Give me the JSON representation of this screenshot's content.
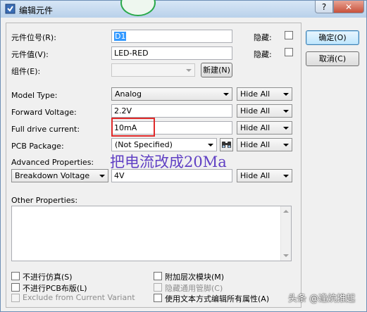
{
  "window": {
    "title": "编辑元件",
    "help_button": "?",
    "close_button": "✕"
  },
  "fields": {
    "ref_label": "元件位号(R):",
    "ref_value": "D1",
    "value_label": "元件值(V):",
    "value_value": "LED-RED",
    "group_label": "组件(E):",
    "new_button": "新建(N)",
    "hidden_label": "隐藏:"
  },
  "properties": [
    {
      "label": "Model Type:",
      "value": "Analog",
      "hide": "Hide All"
    },
    {
      "label": "Forward Voltage:",
      "value": "2.2V",
      "hide": "Hide All"
    },
    {
      "label": "Full drive current:",
      "value": "10mA",
      "hide": "Hide All"
    },
    {
      "label": "PCB Package:",
      "value": "(Not Specified)",
      "hide": "Hide All"
    },
    {
      "label": "Advanced Properties:",
      "value": "4V",
      "hide": "Hide All",
      "selector": "Breakdown Voltage"
    }
  ],
  "other_properties_label": "Other Properties:",
  "options": {
    "left": [
      "不进行仿真(S)",
      "不进行PCB布版(L)",
      "Exclude from Current Variant"
    ],
    "right": [
      "附加层次模块(M)",
      "隐藏通用管脚(C)",
      "使用文本方式编辑所有属性(A)"
    ]
  },
  "buttons": {
    "ok": "确定(O)",
    "cancel": "取消(C)"
  },
  "annotation": "把电流改成20Ma",
  "watermark": "头条 @逢炕推起"
}
